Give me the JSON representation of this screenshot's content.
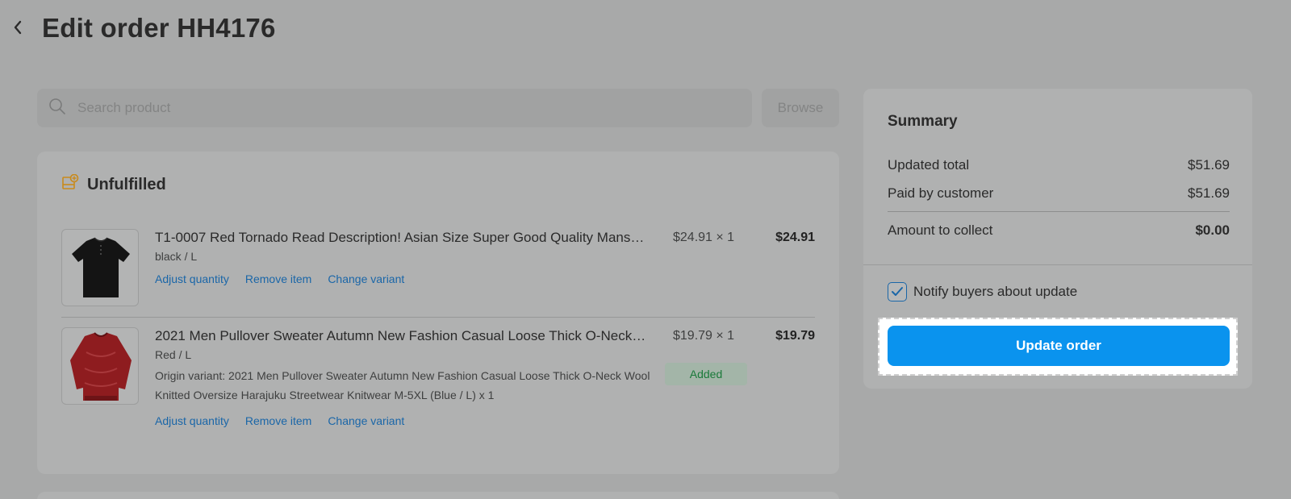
{
  "header": {
    "title": "Edit order HH4176"
  },
  "search": {
    "placeholder": "Search product",
    "browse_label": "Browse"
  },
  "unfulfilled": {
    "title": "Unfulfilled",
    "items": [
      {
        "title": "T1-0007 Red Tornado Read Description! Asian Size Super Good Quality Mans…",
        "variant": "black / L",
        "unit_price": "$24.91 × 1",
        "total": "$24.91",
        "actions": [
          "Adjust quantity",
          "Remove item",
          "Change variant"
        ]
      },
      {
        "title": "2021 Men Pullover Sweater Autumn New Fashion Casual Loose Thick O-Neck…",
        "variant": "Red / L",
        "origin_variant": "Origin variant: 2021 Men Pullover Sweater Autumn New Fashion Casual Loose Thick O-Neck Wool Knitted Oversize Harajuku Streetwear Knitwear M-5XL (Blue / L) x 1",
        "badge": "Added",
        "unit_price": "$19.79 × 1",
        "total": "$19.79",
        "actions": [
          "Adjust quantity",
          "Remove item",
          "Change variant"
        ]
      }
    ]
  },
  "summary": {
    "title": "Summary",
    "rows": [
      {
        "label": "Updated total",
        "value": "$51.69"
      },
      {
        "label": "Paid by customer",
        "value": "$51.69"
      },
      {
        "label": "Amount to collect",
        "value": "$0.00"
      }
    ],
    "notify_label": "Notify buyers about update",
    "notify_checked": true,
    "update_label": "Update order"
  },
  "colors": {
    "primary": "#0a93ee",
    "link": "#1a66a8",
    "added_badge_text": "#1a7a3a",
    "icon_accent": "#c98a1a"
  }
}
